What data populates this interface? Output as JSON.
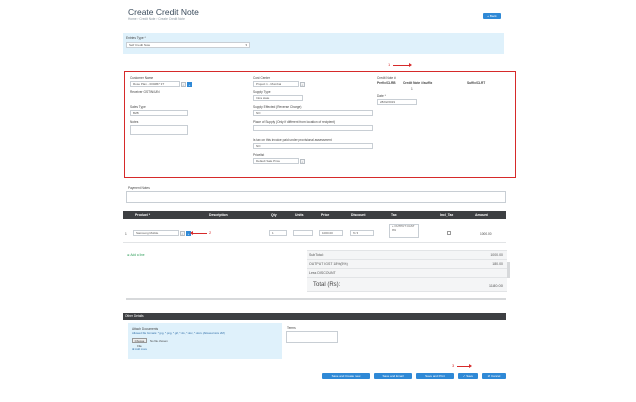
{
  "header": {
    "title": "Create Credit Note",
    "breadcrumb": "Home › Credit Note › Create Credit Note",
    "back_label": "« Back"
  },
  "top_panel": {
    "label": "Entries Type *",
    "value": "Self Credit Note",
    "arrow_down": "▾"
  },
  "markers": {
    "one": "1",
    "two": "2",
    "three": "3"
  },
  "form": {
    "customer_label": "Customer Name",
    "customer_value": "Rose Plan - 0002B7 3T",
    "receiver_label": "Receiver GSTIN/UIN",
    "sales_type_label": "Sales Type",
    "sales_type_value": "B2B",
    "notes_label": "Notes",
    "cost_center_label": "Cost Center",
    "cost_center_value": "Project 1 - Mumbai",
    "supply_type_label": "Supply Type",
    "supply_type_value": "Intra state",
    "supply_reverse_label": "Supply Effected (Reverse Charge)",
    "supply_reverse_value": "NO",
    "place_diff_label": "Place of Supply (Only if different from location of recipient)",
    "sec7_label": "Is tax on this invoice paid under provisional assessment",
    "sec7_value": "NO",
    "pricelist_label": "Pricelist",
    "pricelist_value": "Default Sale Price",
    "credit_no_label": "Credit Note #",
    "prefix_label": "Prefix/CLRB",
    "credit_no_col": "Credit Note #/suffix",
    "suffix_label": "Suffix/CLRT",
    "credit_no_value": "1",
    "date_label": "Date *",
    "date_value": "28/02/2019",
    "search_icon_glyph": "⌕",
    "plus_glyph": "+"
  },
  "textarea_label": "Payment Notes",
  "table": {
    "headers": [
      "Product *",
      "Description",
      "Qty",
      "Units",
      "Price",
      "Discount",
      "Tax",
      "Incl_Tax",
      "Amount"
    ],
    "row": {
      "index": "1",
      "product": "Samsung Mobile",
      "qty": "1",
      "price": "1000.00",
      "discount": "% ▾",
      "tax": "+ OUTPUT CGST 9%",
      "amount": "1000.00"
    },
    "add_line": "⊕ Add a line"
  },
  "summary": {
    "subtotal_label": "SubTotal:",
    "subtotal_value": "1000.00",
    "tax_label": "OUTPUT IGST 18%(5%)",
    "tax_value": "180.00",
    "discount_label": "Less DISCOUNT",
    "total_label": "Total (Rs):",
    "total_value": "1180.00"
  },
  "other_details": {
    "bar": "Other Details",
    "attach_title": "Attach Documents",
    "attach_hint": "Allowed file formats: *.jpg, *.png, *.gif, *.xls, *.doc, *.docx (Allowed size 2M)",
    "choose_label": "Choose File",
    "no_file": "No file chosen",
    "add_more": "⊕ Add more",
    "terms_label": "Terms"
  },
  "footer": {
    "save_add_new": "Save and Create new",
    "save_email": "Save and Email",
    "save_print": "Save and Print",
    "save": "✓ Save",
    "cancel": "⊘ Cancel"
  },
  "colors": {
    "accent": "#2f89d6",
    "highlight": "#d62a2a",
    "panel": "#dff1fb",
    "dark": "#3d3f42"
  }
}
